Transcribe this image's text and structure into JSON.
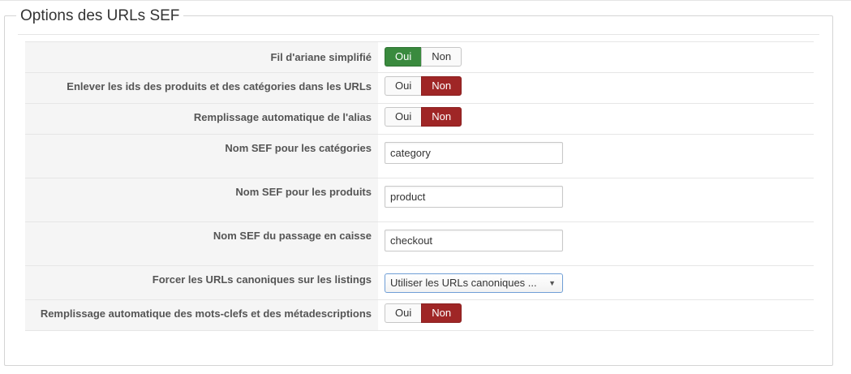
{
  "legend": "Options des URLs SEF",
  "rows": [
    {
      "label": "Fil d'ariane simplifié",
      "type": "toggle",
      "yes": "Oui",
      "no": "Non",
      "selected": "yes"
    },
    {
      "label": "Enlever les ids des produits et des catégories dans les URLs",
      "type": "toggle",
      "yes": "Oui",
      "no": "Non",
      "selected": "no"
    },
    {
      "label": "Remplissage automatique de l'alias",
      "type": "toggle",
      "yes": "Oui",
      "no": "Non",
      "selected": "no"
    },
    {
      "label": "Nom SEF pour les catégories",
      "type": "text",
      "value": "category"
    },
    {
      "label": "Nom SEF pour les produits",
      "type": "text",
      "value": "product"
    },
    {
      "label": "Nom SEF du passage en caisse",
      "type": "text",
      "value": "checkout"
    },
    {
      "label": "Forcer les URLs canoniques sur les listings",
      "type": "select",
      "value": "Utiliser les URLs canoniques ..."
    },
    {
      "label": "Remplissage automatique des mots-clefs et des métadescriptions",
      "type": "toggle",
      "yes": "Oui",
      "no": "Non",
      "selected": "no"
    }
  ],
  "colors": {
    "yes_active": "#3a8a3e",
    "no_active": "#9f2626",
    "select_border": "#6f9ed6"
  }
}
